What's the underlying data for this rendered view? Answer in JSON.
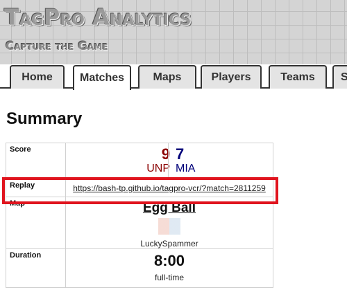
{
  "site": {
    "title": "TagPro Analytics",
    "subtitle": "Capture the Game"
  },
  "nav": {
    "tabs": [
      {
        "label": "Home",
        "active": false
      },
      {
        "label": "Matches",
        "active": true
      },
      {
        "label": "Maps",
        "active": false
      },
      {
        "label": "Players",
        "active": false
      },
      {
        "label": "Teams",
        "active": false
      },
      {
        "label": "S",
        "active": false
      }
    ]
  },
  "summary": {
    "title": "Summary",
    "score": {
      "label": "Score",
      "red": {
        "score": "9",
        "team": "UNP"
      },
      "blue": {
        "score": "7",
        "team": "MIA"
      }
    },
    "replay": {
      "label": "Replay",
      "url": "https://bash-tp.github.io/tagpro-vcr/?match=2811259"
    },
    "map": {
      "label": "Map",
      "name": "Egg Ball",
      "author": "LuckySpammer"
    },
    "duration": {
      "label": "Duration",
      "value": "8:00",
      "note": "full-time"
    }
  },
  "colors": {
    "red_team": "#8b0000",
    "blue_team": "#00007a",
    "highlight": "#e0141e"
  }
}
